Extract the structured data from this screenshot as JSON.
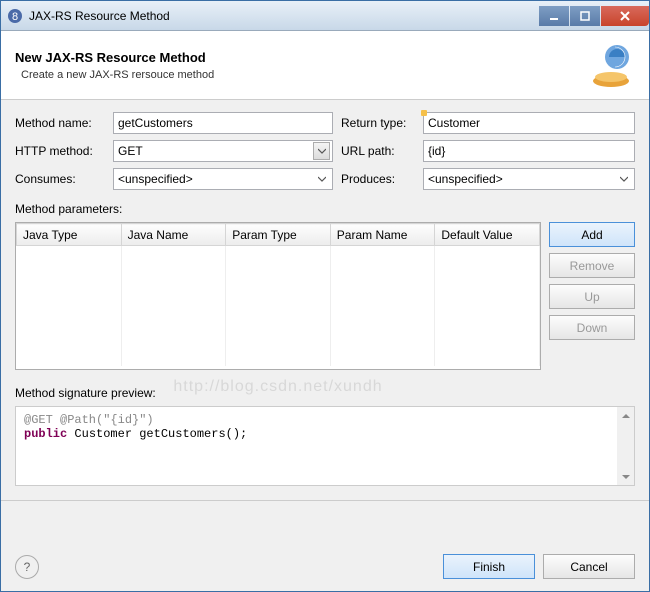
{
  "window": {
    "title": "JAX-RS Resource Method"
  },
  "header": {
    "title": "New JAX-RS Resource Method",
    "subtitle": "Create a new JAX-RS rersouce method"
  },
  "form": {
    "methodName": {
      "label": "Method name:",
      "value": "getCustomers"
    },
    "returnType": {
      "label": "Return type:",
      "value": "Customer"
    },
    "httpMethod": {
      "label": "HTTP method:",
      "value": "GET"
    },
    "urlPath": {
      "label": "URL path:",
      "value": "{id}"
    },
    "consumes": {
      "label": "Consumes:",
      "value": "<unspecified>"
    },
    "produces": {
      "label": "Produces:",
      "value": "<unspecified>"
    }
  },
  "paramsLabel": "Method parameters:",
  "paramsColumns": [
    "Java Type",
    "Java Name",
    "Param Type",
    "Param Name",
    "Default Value"
  ],
  "sideButtons": {
    "add": "Add",
    "remove": "Remove",
    "up": "Up",
    "down": "Down"
  },
  "preview": {
    "label": "Method signature preview:",
    "line1_anno": "@GET @Path(\"{id}\")",
    "line2_kw": "public",
    "line2_rest": " Customer getCustomers();"
  },
  "footer": {
    "finish": "Finish",
    "cancel": "Cancel"
  },
  "watermark": "http://blog.csdn.net/xundh"
}
